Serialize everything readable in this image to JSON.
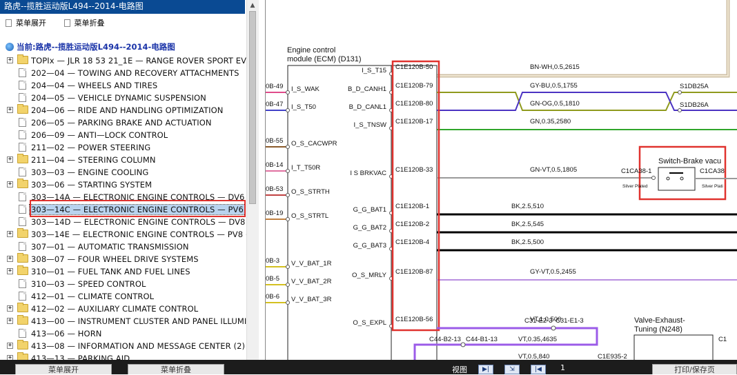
{
  "window": {
    "title": "路虎--揽胜运动版L494--2014-电路图"
  },
  "menu": {
    "expand_label": "菜单展开",
    "collapse_label": "菜单折叠"
  },
  "current_path": {
    "label": "当前:路虎--揽胜运动版L494--2014-电路图"
  },
  "tree": {
    "items": [
      {
        "label": "TOPIx — JLR 18 53 21_1E — RANGE ROVER SPORT EV",
        "icon": "folder-icon",
        "expandable": true
      },
      {
        "label": "202—04 — TOWING AND RECOVERY ATTACHMENTS",
        "icon": "doc-icon",
        "expandable": false
      },
      {
        "label": "204—04 — WHEELS AND TIRES",
        "icon": "doc-icon",
        "expandable": false
      },
      {
        "label": "204—05 — VEHICLE DYNAMIC SUSPENSION",
        "icon": "doc-icon",
        "expandable": false
      },
      {
        "label": "204—06 — RIDE AND HANDLING OPTIMIZATION",
        "icon": "folder-icon",
        "expandable": true
      },
      {
        "label": "206—05 — PARKING BRAKE AND ACTUATION",
        "icon": "doc-icon",
        "expandable": false
      },
      {
        "label": "206—09 — ANTI—LOCK CONTROL",
        "icon": "doc-icon",
        "expandable": false
      },
      {
        "label": "211—02 — POWER STEERING",
        "icon": "doc-icon",
        "expandable": false
      },
      {
        "label": "211—04 — STEERING COLUMN",
        "icon": "folder-icon",
        "expandable": true
      },
      {
        "label": "303—03 — ENGINE COOLING",
        "icon": "doc-icon",
        "expandable": false
      },
      {
        "label": "303—06 — STARTING SYSTEM",
        "icon": "folder-icon",
        "expandable": true
      },
      {
        "label": "303—14A — ELECTRONIC ENGINE CONTROLS — DV6",
        "icon": "doc-icon",
        "expandable": false
      },
      {
        "label": "303—14C — ELECTRONIC ENGINE CONTROLS — PV6",
        "icon": "doc-icon",
        "expandable": false,
        "selected": true
      },
      {
        "label": "303—14D — ELECTRONIC ENGINE CONTROLS — DV8",
        "icon": "doc-icon",
        "expandable": false
      },
      {
        "label": "303—14E — ELECTRONIC ENGINE CONTROLS — PV8 (",
        "icon": "folder-icon",
        "expandable": true
      },
      {
        "label": "307—01 — AUTOMATIC TRANSMISSION",
        "icon": "doc-icon",
        "expandable": false
      },
      {
        "label": "308—07 — FOUR WHEEL DRIVE SYSTEMS",
        "icon": "folder-icon",
        "expandable": true
      },
      {
        "label": "310—01 — FUEL TANK AND FUEL LINES",
        "icon": "folder-icon",
        "expandable": true
      },
      {
        "label": "310—03 — SPEED CONTROL",
        "icon": "doc-icon",
        "expandable": false
      },
      {
        "label": "412—01 — CLIMATE CONTROL",
        "icon": "doc-icon",
        "expandable": false
      },
      {
        "label": "412—02 — AUXILIARY CLIMATE CONTROL",
        "icon": "folder-icon",
        "expandable": true
      },
      {
        "label": "413—00 — INSTRUMENT CLUSTER AND PANEL ILLUMI",
        "icon": "folder-icon",
        "expandable": true
      },
      {
        "label": "413—06 — HORN",
        "icon": "doc-icon",
        "expandable": false
      },
      {
        "label": "413—08 — INFORMATION AND MESSAGE CENTER (2)",
        "icon": "folder-icon",
        "expandable": true
      },
      {
        "label": "413—13 — PARKING AID",
        "icon": "folder-icon",
        "expandable": true
      }
    ]
  },
  "diagram": {
    "module_title_line1": "Engine control",
    "module_title_line2": "module (ECM) (D131)",
    "switch_title": "Switch-Brake vacu",
    "valve_title_line1": "Valve-Exhaust-",
    "valve_title_line2": "Tuning (N248)",
    "right_pins": [
      {
        "signal": "I_S_T15",
        "pin": "C1E120B-50",
        "wire": "BN-WH,0.5,2615",
        "color": "#d9c9b0"
      },
      {
        "signal": "B_D_CANH1",
        "pin": "C1E120B-79",
        "wire": "GY-BU,0.5,1755",
        "color": "#8f9a1c",
        "end": "S1DB25A"
      },
      {
        "signal": "B_D_CANL1",
        "pin": "C1E120B-80",
        "wire": "GN-OG,0.5,1810",
        "color": "#4a32c2",
        "end": "S1DB26A"
      },
      {
        "signal": "I_S_TNSW",
        "pin": "C1E120B-17",
        "wire": "GN,0.35,2580",
        "color": "#2fa52a"
      },
      {
        "signal": "I S BRKVAC",
        "pin": "C1E120B-33",
        "wire": "GN-VT,0.5,1805",
        "color": "#9a9a9a"
      },
      {
        "signal": "G_G_BAT1",
        "pin": "C1E120B-1",
        "wire": "BK,2.5,510",
        "color": "#000000"
      },
      {
        "signal": "G_G_BAT2",
        "pin": "C1E120B-2",
        "wire": "BK,2.5,545",
        "color": "#000000"
      },
      {
        "signal": "G_G_BAT3",
        "pin": "C1E120B-4",
        "wire": "BK,2.5,500",
        "color": "#000000"
      },
      {
        "signal": "O_S_MRLY",
        "pin": "C1E120B-87",
        "wire": "GY-VT,0.5,2455",
        "color": "#b98ee0"
      },
      {
        "signal": "O_S_EXPL",
        "pin": "C1E120B-56",
        "wire": "VT,1.0,500",
        "color": "#9b5be8"
      }
    ],
    "left_pins": [
      {
        "signal": "I_S_WAK",
        "ref": "0B-49",
        "color": "#e04a8a"
      },
      {
        "signal": "I_S_T50",
        "ref": "0B-47",
        "color": "#4040c8"
      },
      {
        "signal": "O_S_CACWPR",
        "ref": "0B-55",
        "color": "#8a5a2a"
      },
      {
        "signal": "I_T_T50R",
        "ref": "0B-14",
        "color": "#e070a0"
      },
      {
        "signal": "O_S_STRTH",
        "ref": "0B-53",
        "color": "#c04040"
      },
      {
        "signal": "O_S_STRTL",
        "ref": "0B-19",
        "color": "#c08040"
      },
      {
        "signal": "V_V_BAT_1R",
        "ref": "0B-3",
        "color": "#d4c020"
      },
      {
        "signal": "V_V_BAT_2R",
        "ref": "0B-5",
        "color": "#d4c020"
      },
      {
        "signal": "V_V_BAT_3R",
        "ref": "0B-6",
        "color": "#d4c020"
      }
    ],
    "switch_connector_left": "C1CA38-1",
    "switch_connector_right": "C1CA38",
    "switch_plating_left": "Silver Plated",
    "switch_plating_right": "Silver Plati",
    "lower": {
      "c31_left": "C31-E2-3",
      "c31_right": "C31-E1-3",
      "c44_left": "C44-B2-13",
      "c44_right": "C44-B1-13",
      "wire_mid": "VT,0.35,4635",
      "wire_low": "VT,0.5,840",
      "c1e935": "C1E935-2",
      "c1_right": "C1"
    }
  },
  "bottom": {
    "view_label": "视图",
    "page_number": "1",
    "btn_left1": "菜单展开",
    "btn_left2": "菜单折叠",
    "btn_right": "打印/保存页"
  }
}
